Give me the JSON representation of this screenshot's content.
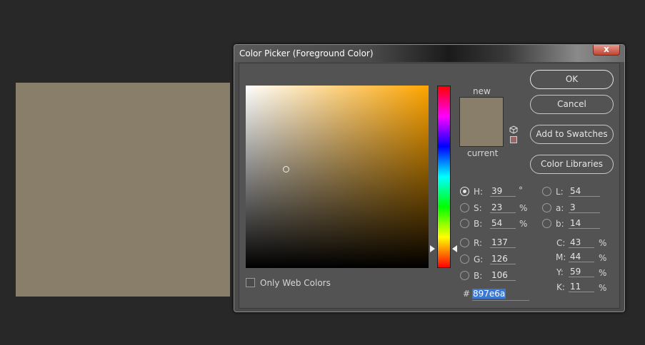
{
  "colors": {
    "current": "#897e6a",
    "new": "#897e6a",
    "hue_pure": "#ffa500"
  },
  "dialog": {
    "title": "Color Picker (Foreground Color)",
    "close_label": "x"
  },
  "compare": {
    "new_label": "new",
    "current_label": "current"
  },
  "buttons": {
    "ok": "OK",
    "cancel": "Cancel",
    "add_to_swatches": "Add to Swatches",
    "color_libraries": "Color Libraries"
  },
  "hsb": {
    "h": {
      "label": "H:",
      "value": "39",
      "unit": "°",
      "selected": true
    },
    "s": {
      "label": "S:",
      "value": "23",
      "unit": "%"
    },
    "b": {
      "label": "B:",
      "value": "54",
      "unit": "%"
    }
  },
  "rgb": {
    "r": {
      "label": "R:",
      "value": "137"
    },
    "g": {
      "label": "G:",
      "value": "126"
    },
    "b": {
      "label": "B:",
      "value": "106"
    }
  },
  "lab": {
    "l": {
      "label": "L:",
      "value": "54"
    },
    "a": {
      "label": "a:",
      "value": "3"
    },
    "b": {
      "label": "b:",
      "value": "14"
    }
  },
  "cmyk": {
    "c": {
      "label": "C:",
      "value": "43",
      "unit": "%"
    },
    "m": {
      "label": "M:",
      "value": "44",
      "unit": "%"
    },
    "y": {
      "label": "Y:",
      "value": "59",
      "unit": "%"
    },
    "k": {
      "label": "K:",
      "value": "11",
      "unit": "%"
    }
  },
  "hex": {
    "symbol": "#",
    "value": "897e6a"
  },
  "only_web_colors": {
    "label": "Only Web Colors",
    "checked": false
  }
}
